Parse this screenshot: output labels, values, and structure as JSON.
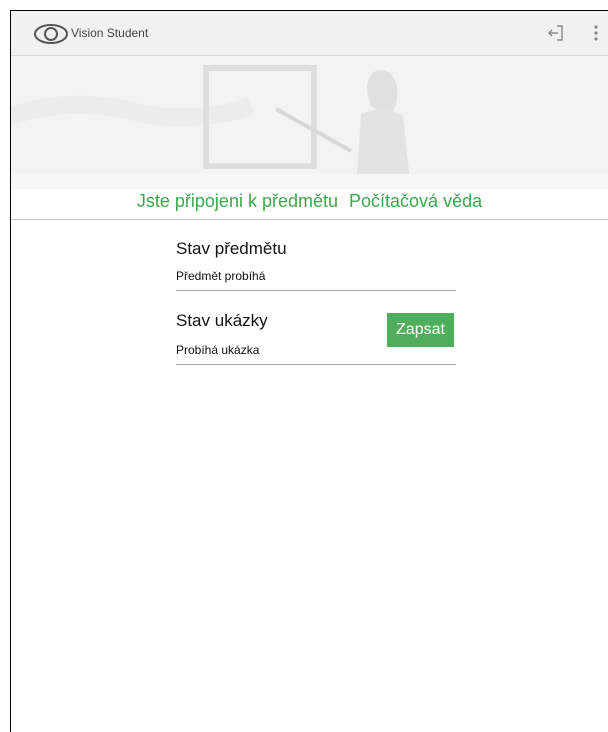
{
  "topbar": {
    "app_title": "Vision Student",
    "icons": [
      "eye-icon",
      "exit-icon",
      "more-vert-icon"
    ]
  },
  "banner": {
    "connected_text": "Jste připojeni k předmětu",
    "course_name": "Počítačová věda"
  },
  "course_status": {
    "title": "Stav předmětu",
    "value": "Předmět probíhá"
  },
  "demo_status": {
    "title": "Stav ukázky",
    "value": "Probíhá ukázka",
    "button_label": "Zapsat"
  },
  "colors": {
    "accent": "#3aa84a",
    "button": "#4fae5c",
    "topbar": "#f1f1f1"
  }
}
